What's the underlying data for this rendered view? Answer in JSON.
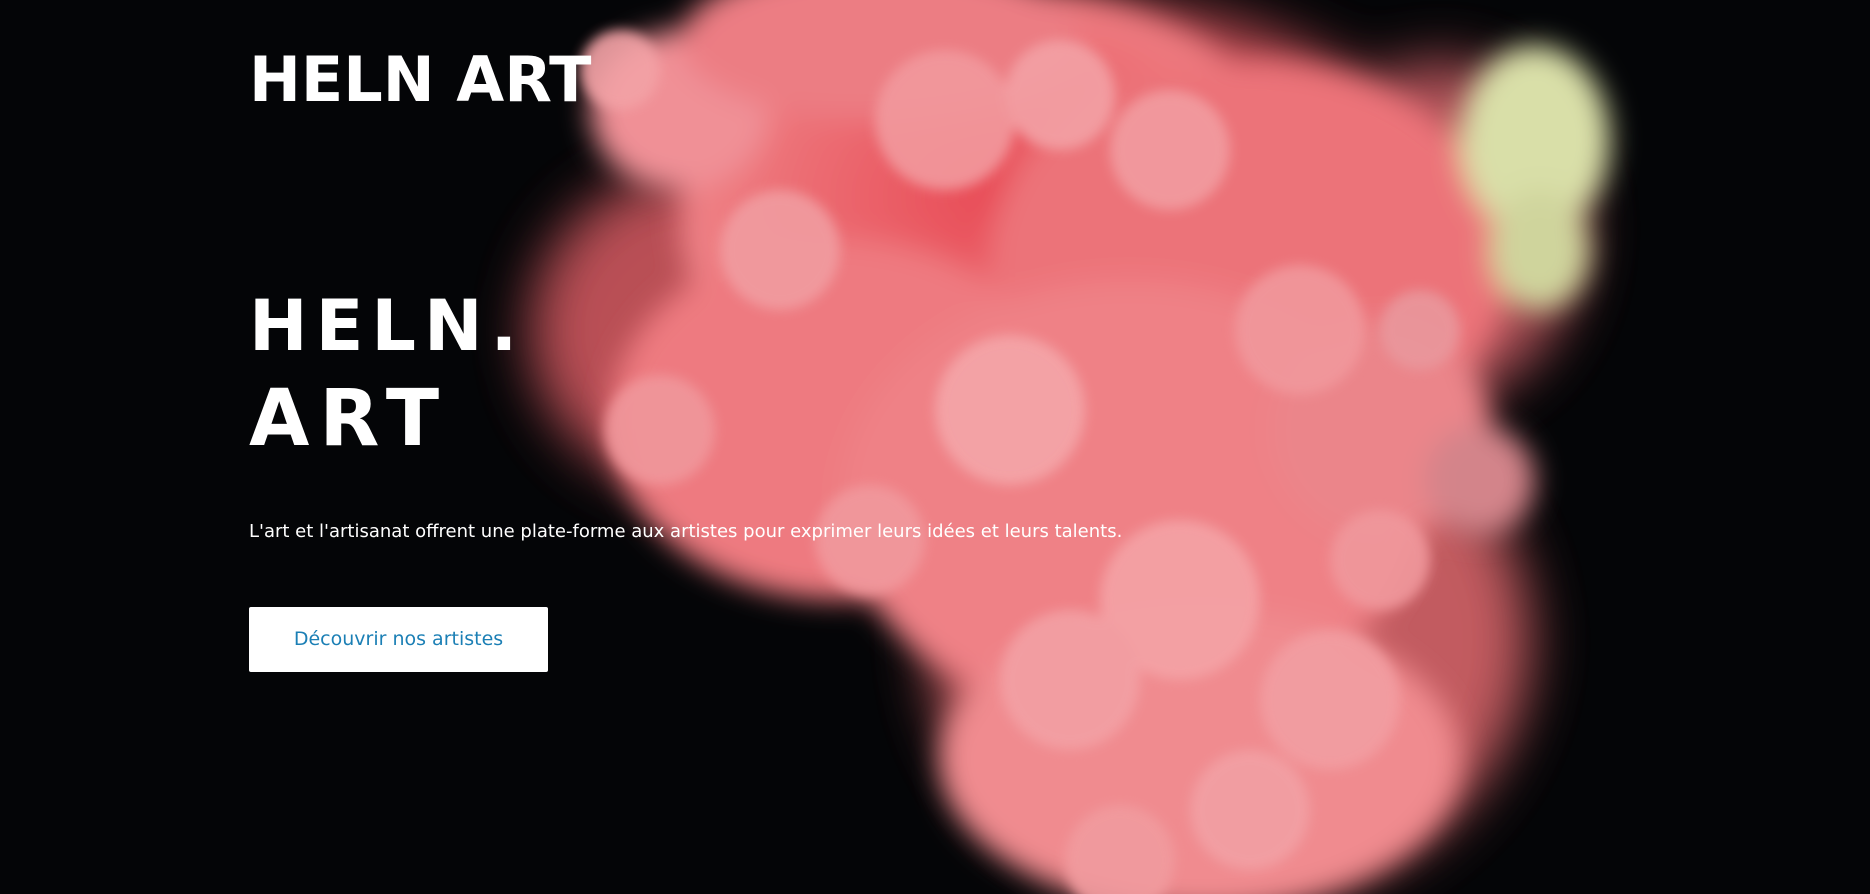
{
  "header": {
    "logo_text": "HELN ART"
  },
  "hero": {
    "title_line1": "HELN.",
    "title_line2": "ART",
    "tagline": "L'art et l'artisanat offrent une plate-forme aux artistes pour exprimer leurs idées et leurs talents.",
    "cta_label": "Découvrir nos artistes",
    "background_image": "pink-ink-smoke-cloud"
  },
  "colors": {
    "background": "#050608",
    "text": "#ffffff",
    "smoke_primary": "#ec6f75",
    "smoke_light": "#f5a3a6",
    "smoke_yellow": "#ecefc4",
    "button_bg": "#ffffff",
    "button_text": "#1b7fb5"
  }
}
